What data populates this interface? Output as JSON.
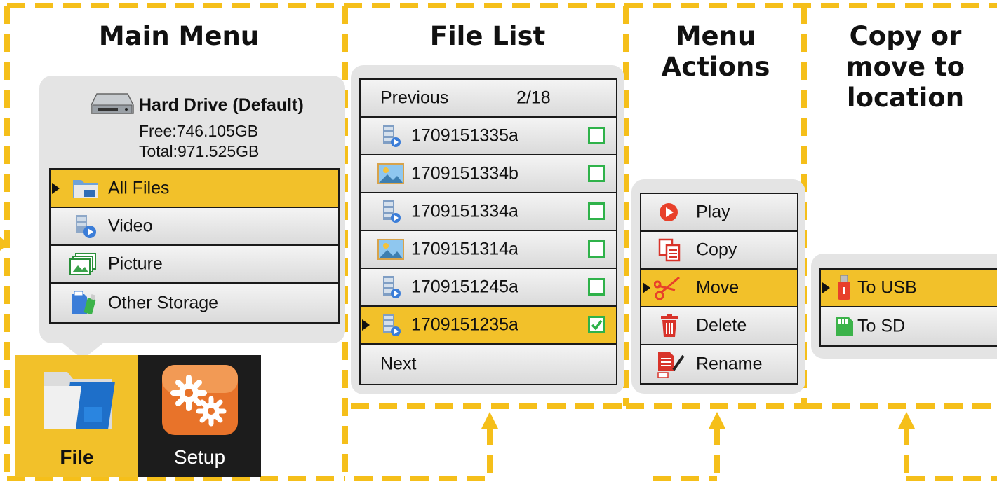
{
  "columns": {
    "main_menu": "Main Menu",
    "file_list": "File List",
    "menu_actions": [
      "Menu",
      "Actions"
    ],
    "copy_move": [
      "Copy or",
      "move to",
      "location"
    ]
  },
  "drive": {
    "name": "Hard Drive (Default)",
    "free": "Free:746.105GB",
    "total": "Total:971.525GB"
  },
  "main_menu": {
    "items": [
      {
        "label": "All Files",
        "icon": "folder-icon",
        "selected": true
      },
      {
        "label": "Video",
        "icon": "video-icon",
        "selected": false
      },
      {
        "label": "Picture",
        "icon": "picture-icon",
        "selected": false
      },
      {
        "label": "Other Storage",
        "icon": "other-storage-icon",
        "selected": false
      }
    ]
  },
  "tabs": [
    {
      "label": "File",
      "icon": "file-folder-icon",
      "active": true
    },
    {
      "label": "Setup",
      "icon": "gears-icon",
      "active": false
    }
  ],
  "file_list": {
    "previous": "Previous",
    "page": "2/18",
    "next": "Next",
    "files": [
      {
        "name": "1709151335a",
        "type": "video",
        "checked": false,
        "selected": false
      },
      {
        "name": "1709151334b",
        "type": "picture",
        "checked": false,
        "selected": false
      },
      {
        "name": "1709151334a",
        "type": "video",
        "checked": false,
        "selected": false
      },
      {
        "name": "1709151314a",
        "type": "picture",
        "checked": false,
        "selected": false
      },
      {
        "name": "1709151245a",
        "type": "video",
        "checked": false,
        "selected": false
      },
      {
        "name": "1709151235a",
        "type": "video",
        "checked": true,
        "selected": true
      }
    ]
  },
  "actions": {
    "items": [
      {
        "label": "Play",
        "icon": "play-icon",
        "selected": false
      },
      {
        "label": "Copy",
        "icon": "copy-icon",
        "selected": false
      },
      {
        "label": "Move",
        "icon": "scissors-icon",
        "selected": true
      },
      {
        "label": "Delete",
        "icon": "trash-icon",
        "selected": false
      },
      {
        "label": "Rename",
        "icon": "rename-icon",
        "selected": false
      }
    ]
  },
  "locations": {
    "items": [
      {
        "label": "To USB",
        "icon": "usb-icon",
        "selected": true
      },
      {
        "label": "To SD",
        "icon": "sd-card-icon",
        "selected": false
      }
    ]
  },
  "colors": {
    "accent": "#f2c12a",
    "dash": "#f5bf1a",
    "check": "#2fb24a",
    "tab_dark": "#1c1c1c",
    "setup_orange": "#e8732a"
  }
}
